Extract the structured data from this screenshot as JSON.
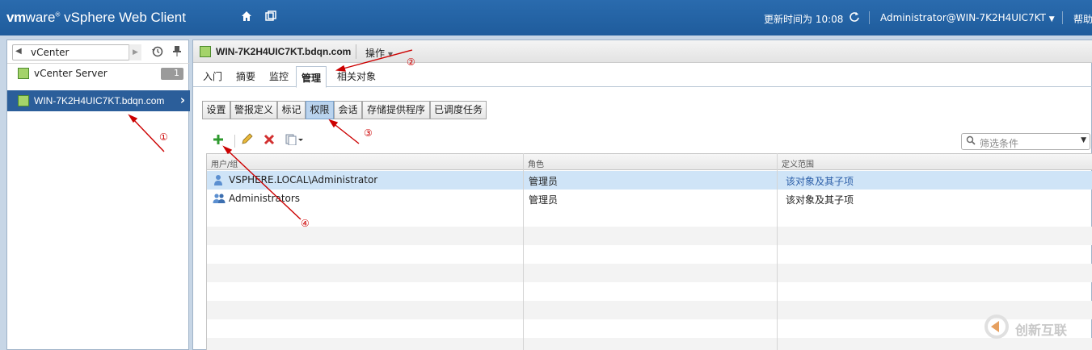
{
  "header": {
    "brand_vm": "vm",
    "brand_ware": "ware",
    "brand_product": "vSphere Web Client",
    "update_label": "更新时间为 10:08",
    "user": "Administrator@WIN-7K2H4UIC7KT",
    "help": "帮助"
  },
  "navigator": {
    "nav_label": "vCenter",
    "vcenter_server": "vCenter Server",
    "vcenter_count": "1",
    "selected_host": "WIN-7K2H4UIC7KT.bdqn.com"
  },
  "main": {
    "object_title": "WIN-7K2H4UIC7KT.bdqn.com",
    "actions_label": "操作",
    "tabs": [
      "入门",
      "摘要",
      "监控",
      "管理",
      "相关对象"
    ],
    "active_tab": "管理",
    "subtabs": [
      "设置",
      "警报定义",
      "标记",
      "权限",
      "会话",
      "存储提供程序",
      "已调度任务"
    ],
    "active_subtab": "权限",
    "filter_placeholder": "筛选条件",
    "columns": [
      "用户/组",
      "角色",
      "定义范围"
    ],
    "rows": [
      {
        "user": "VSPHERE.LOCAL\\Administrator",
        "role": "管理员",
        "scope": "该对象及其子项"
      },
      {
        "user": "Administrators",
        "role": "管理员",
        "scope": "该对象及其子项"
      }
    ]
  },
  "annotations": [
    "①",
    "②",
    "③",
    "④"
  ],
  "watermark": "创新互联",
  "colors": {
    "topbar": "#1f5c9c",
    "selected_nav": "#2b5e9a",
    "annotation": "#cc0000",
    "selected_row": "#cfe4f7"
  }
}
